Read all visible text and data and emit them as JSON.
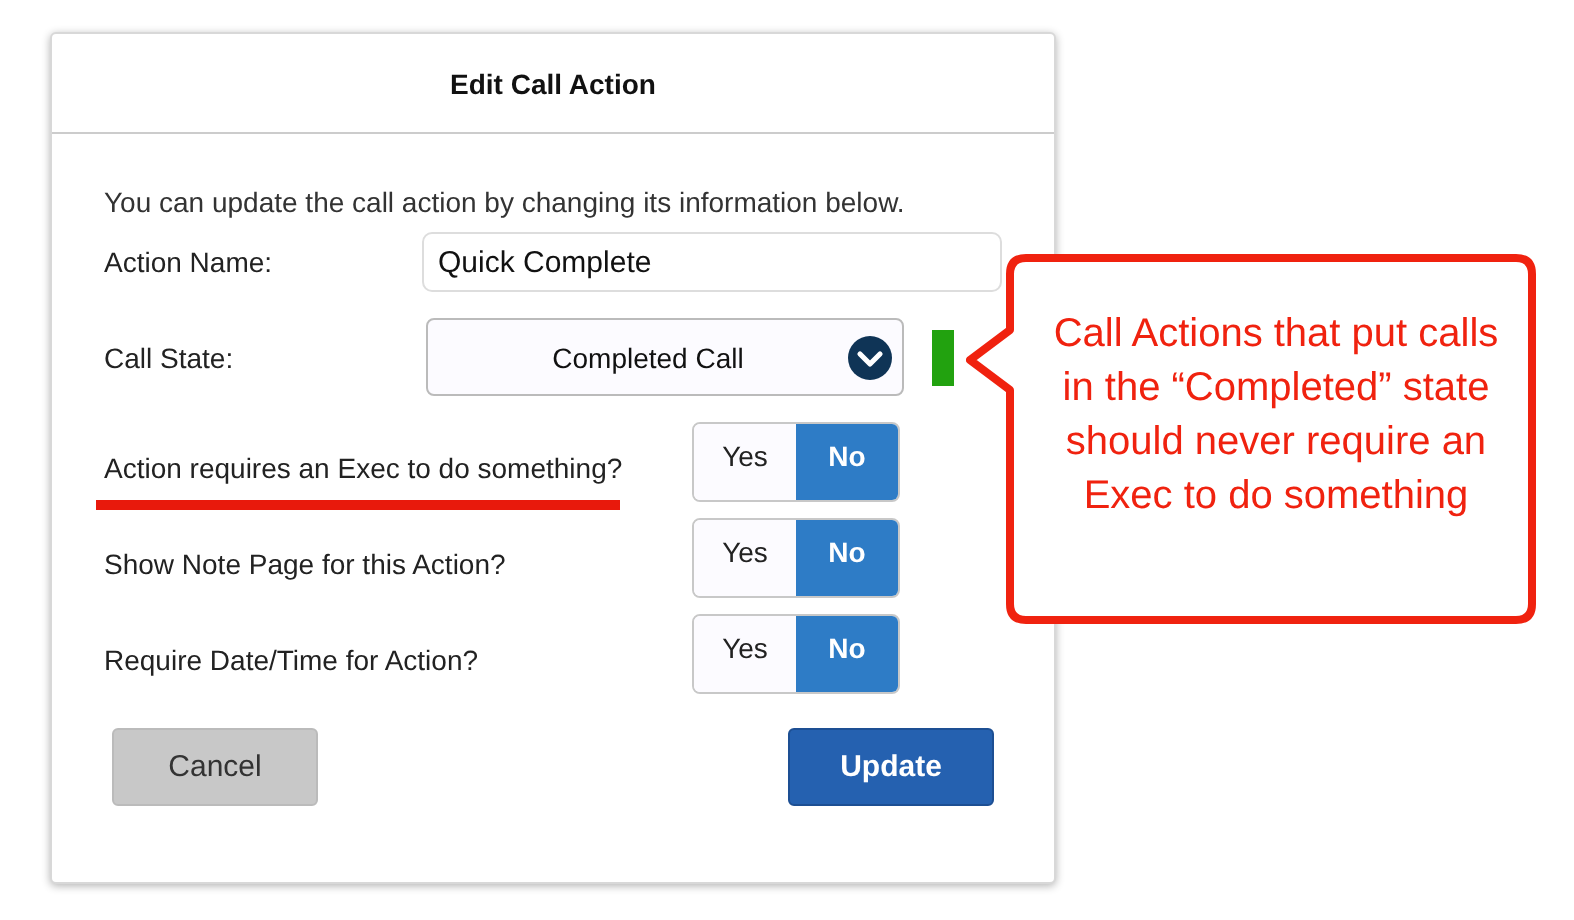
{
  "dialog": {
    "title": "Edit Call Action",
    "description": "You can update the call action by changing its information below.",
    "fields": [
      {
        "label": "Action Name:",
        "value": "Quick Complete"
      },
      {
        "label": "Call State:",
        "value": "Completed Call"
      }
    ],
    "questions": [
      {
        "label": "Action requires an Exec to do something?",
        "highlighted": true,
        "options": [
          {
            "label": "Yes",
            "selected": false
          },
          {
            "label": "No",
            "selected": true
          }
        ]
      },
      {
        "label": "Show Note Page for this Action?",
        "highlighted": false,
        "options": [
          {
            "label": "Yes",
            "selected": false
          },
          {
            "label": "No",
            "selected": true
          }
        ]
      },
      {
        "label": "Require Date/Time for Action?",
        "highlighted": false,
        "options": [
          {
            "label": "Yes",
            "selected": false
          },
          {
            "label": "No",
            "selected": true
          }
        ]
      }
    ],
    "buttons": [
      {
        "label": "Cancel",
        "kind": "secondary"
      },
      {
        "label": "Update",
        "kind": "primary"
      }
    ]
  },
  "callout": {
    "text": "Call Actions that put calls in the “Completed” state should never require an Exec to do something"
  }
}
